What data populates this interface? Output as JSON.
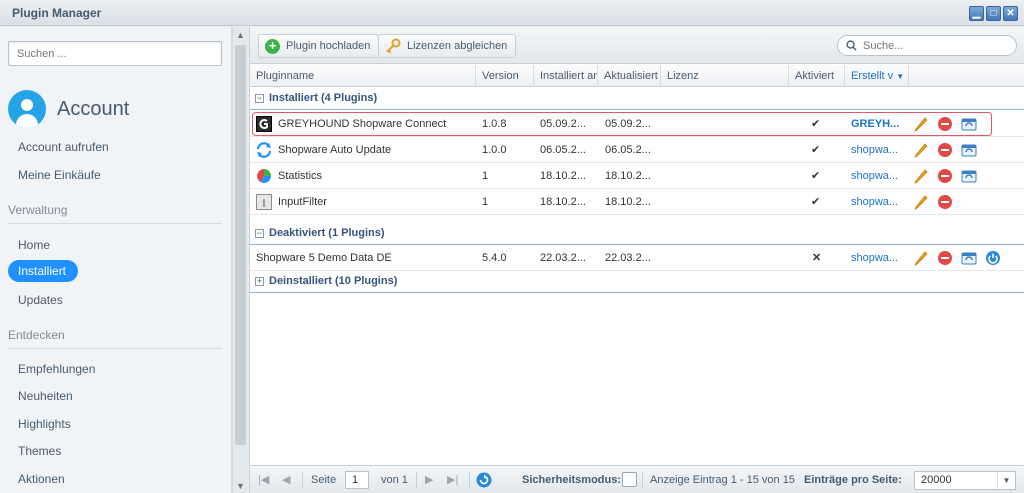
{
  "window": {
    "title": "Plugin Manager"
  },
  "sidebar": {
    "search_placeholder": "Suchen ...",
    "account_label": "Account",
    "account_items": [
      "Account aufrufen",
      "Meine Einkäufe"
    ],
    "sections": [
      {
        "label": "Verwaltung",
        "items": [
          "Home",
          "Installiert",
          "Updates"
        ],
        "active": "Installiert"
      },
      {
        "label": "Entdecken",
        "items": [
          "Empfehlungen",
          "Neuheiten",
          "Highlights",
          "Themes",
          "Aktionen"
        ]
      }
    ]
  },
  "toolbar": {
    "upload_label": "Plugin hochladen",
    "licenses_label": "Lizenzen abgleichen",
    "search_placeholder": "Suche..."
  },
  "columns": [
    "Pluginname",
    "Version",
    "Installiert am",
    "Aktualisiert",
    "Lizenz",
    "Aktiviert",
    "Erstellt v"
  ],
  "groups": {
    "installed": {
      "title": "Installiert (4 Plugins)",
      "rows": [
        {
          "name": "GREYHOUND Shopware Connect",
          "version": "1.0.8",
          "installed": "05.09.2...",
          "updated": "05.09.2...",
          "license": "",
          "active": true,
          "author": "GREYH...",
          "icon": "greyhound-logo-icon"
        },
        {
          "name": "Shopware Auto Update",
          "version": "1.0.0",
          "installed": "06.05.2...",
          "updated": "06.05.2...",
          "license": "",
          "active": true,
          "author": "shopwa...",
          "icon": "auto-update-icon"
        },
        {
          "name": "Statistics",
          "version": "1",
          "installed": "18.10.2...",
          "updated": "18.10.2...",
          "license": "",
          "active": true,
          "author": "shopwa...",
          "icon": "pie-chart-icon"
        },
        {
          "name": "InputFilter",
          "version": "1",
          "installed": "18.10.2...",
          "updated": "18.10.2...",
          "license": "",
          "active": true,
          "author": "shopwa...",
          "icon": "input-filter-icon"
        }
      ]
    },
    "deactivated": {
      "title": "Deaktiviert (1 Plugins)",
      "rows": [
        {
          "name": "Shopware 5 Demo Data DE",
          "version": "5.4.0",
          "installed": "22.03.2...",
          "updated": "22.03.2...",
          "license": "",
          "active": false,
          "author": "shopwa..."
        }
      ]
    },
    "uninstalled": {
      "title": "Deinstalliert (10 Plugins)"
    }
  },
  "paging": {
    "page_label": "Seite",
    "page_value": "1",
    "of_label": "von 1",
    "safemode_label": "Sicherheitsmodus:",
    "display_info": "Anzeige Eintrag 1 - 15 von 15",
    "per_page_label": "Einträge pro Seite:",
    "per_page_value": "20000"
  },
  "colors": {
    "accent": "#1e90ff",
    "link": "#1e72c8",
    "highlight": "#e05a66"
  }
}
